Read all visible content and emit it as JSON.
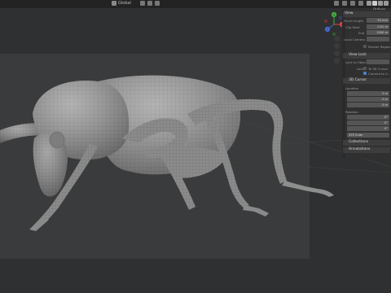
{
  "toolbar": {
    "global_label": "Global",
    "options_label": "Options"
  },
  "npanel": {
    "view_section": "View",
    "focal_label": "Focal Length",
    "focal_value": "50 mm",
    "clip_start_label": "Clip Start",
    "clip_start_value": "0.01 m",
    "end_label": "End",
    "end_value": "1000 m",
    "local_camera_label": "Local Camera",
    "render_region_label": "Render Region",
    "view_lock_section": "View Lock",
    "lock_to_object_label": "Lock to Object",
    "lock_label": "Lock",
    "lock_3d_cursor_label": "To 3D Cursor",
    "camera_to_view_label": "Camera to V...",
    "cursor_section": "3D Cursor",
    "location_label": "Location",
    "loc_x": "0 m",
    "loc_y": "0 m",
    "loc_z": "0 m",
    "rotation_label": "Rotation",
    "rot_x": "0°",
    "rot_y": "0°",
    "rot_z": "0°",
    "rotation_mode": "XYZ Euler",
    "collections_section": "Collections",
    "annotations_section": "Annotations",
    "axis_x": "X",
    "axis_y": "Y",
    "axis_z": "Z"
  }
}
